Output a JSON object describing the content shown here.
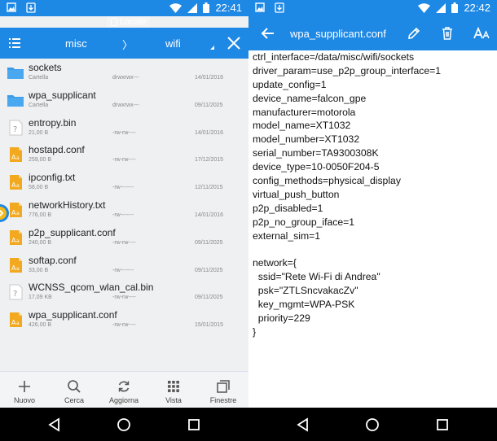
{
  "status": {
    "time_left": "22:41",
    "time_right": "22:42"
  },
  "left": {
    "tab_label": "Locale",
    "path": {
      "folder": "misc",
      "separator": "〉",
      "current": "wifi"
    },
    "files": [
      {
        "name": "sockets",
        "size": "Cartella",
        "perm": "drwxrwx---",
        "date": "14/01/2016",
        "type": "folder"
      },
      {
        "name": "wpa_supplicant",
        "size": "Cartella",
        "perm": "drwxrwx---",
        "date": "09/11/2025",
        "type": "folder"
      },
      {
        "name": "entropy.bin",
        "size": "21,00 B",
        "perm": "-rw-rw----",
        "date": "14/01/2016",
        "type": "unknown"
      },
      {
        "name": "hostapd.conf",
        "size": "259,00 B",
        "perm": "-rw-rw----",
        "date": "17/12/2015",
        "type": "text"
      },
      {
        "name": "ipconfig.txt",
        "size": "58,00 B",
        "perm": "-rw-------",
        "date": "12/11/2015",
        "type": "text"
      },
      {
        "name": "networkHistory.txt",
        "size": "776,00 B",
        "perm": "-rw-------",
        "date": "14/01/2016",
        "type": "text"
      },
      {
        "name": "p2p_supplicant.conf",
        "size": "240,00 B",
        "perm": "-rw-rw----",
        "date": "09/11/2025",
        "type": "text"
      },
      {
        "name": "softap.conf",
        "size": "33,00 B",
        "perm": "-rw-------",
        "date": "09/11/2025",
        "type": "text"
      },
      {
        "name": "WCNSS_qcom_wlan_cal.bin",
        "size": "17,09 KB",
        "perm": "-rw-rw----",
        "date": "09/11/2025",
        "type": "unknown"
      },
      {
        "name": "wpa_supplicant.conf",
        "size": "426,00 B",
        "perm": "-rw-rw----",
        "date": "15/01/2015",
        "type": "text"
      }
    ],
    "toolbar": [
      {
        "label": "Nuovo",
        "icon": "plus-icon"
      },
      {
        "label": "Cerca",
        "icon": "search-icon"
      },
      {
        "label": "Aggiorna",
        "icon": "refresh-icon"
      },
      {
        "label": "Vista",
        "icon": "grid-icon"
      },
      {
        "label": "Finestre",
        "icon": "windows-icon"
      }
    ]
  },
  "right": {
    "title": "wpa_supplicant.conf",
    "lines": [
      "ctrl_interface=/data/misc/wifi/sockets",
      "driver_param=use_p2p_group_interface=1",
      "update_config=1",
      "device_name=falcon_gpe",
      "manufacturer=motorola",
      "model_name=XT1032",
      "model_number=XT1032",
      "serial_number=TA9300308K",
      "device_type=10-0050F204-5",
      "config_methods=physical_display",
      "virtual_push_button",
      "p2p_disabled=1",
      "p2p_no_group_iface=1",
      "external_sim=1",
      "",
      "network={",
      "  ssid=\"Rete Wi-Fi di Andrea\"",
      "  psk=\"ZTLSncvakacZv\"",
      "  key_mgmt=WPA-PSK",
      "  priority=229",
      "}"
    ]
  },
  "colors": {
    "accent": "#1e88e5",
    "folder": "#3b9be8",
    "text_file": "#f2a91f"
  }
}
